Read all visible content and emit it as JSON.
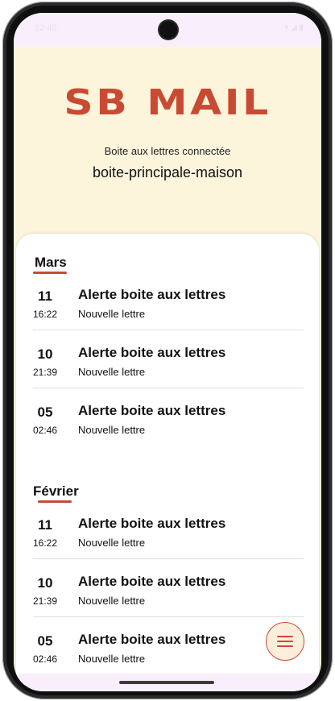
{
  "status_bar": {
    "time": "12:40",
    "icons": "▾ ◢ ▮"
  },
  "header": {
    "logo": "SB MAIL",
    "mailbox_label": "Boite aux lettres connectée",
    "mailbox_name": "boite-principale-maison"
  },
  "sections": [
    {
      "title": "Mars",
      "items": [
        {
          "day": "11",
          "time": "16:22",
          "title": "Alerte boite aux lettres",
          "subtitle": "Nouvelle lettre"
        },
        {
          "day": "10",
          "time": "21:39",
          "title": "Alerte boite aux lettres",
          "subtitle": "Nouvelle lettre"
        },
        {
          "day": "05",
          "time": "02:46",
          "title": "Alerte boite aux lettres",
          "subtitle": "Nouvelle lettre"
        }
      ]
    },
    {
      "title": "Février",
      "items": [
        {
          "day": "11",
          "time": "16:22",
          "title": "Alerte boite aux lettres",
          "subtitle": "Nouvelle lettre"
        },
        {
          "day": "10",
          "time": "21:39",
          "title": "Alerte boite aux lettres",
          "subtitle": "Nouvelle lettre"
        },
        {
          "day": "05",
          "time": "02:46",
          "title": "Alerte boite aux lettres",
          "subtitle": "Nouvelle lettre"
        }
      ]
    }
  ],
  "fab": {
    "icon": "menu-icon"
  },
  "colors": {
    "accent": "#c94a33",
    "header_bg": "#fdf4dc",
    "fab_bg": "#fdeedc"
  }
}
